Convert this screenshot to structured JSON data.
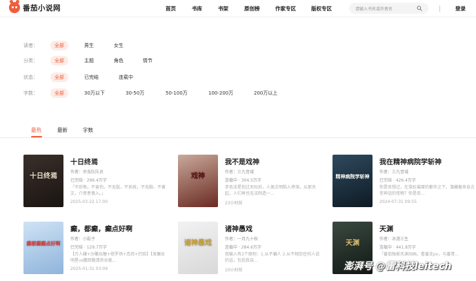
{
  "header": {
    "logo_text": "番茄小说网",
    "nav": [
      "首页",
      "书库",
      "书架",
      "原创榜",
      "作家专区",
      "版权专区"
    ],
    "active_nav": 1,
    "search_placeholder": "请输入书名或作者名",
    "login_label": "登录"
  },
  "filters": [
    {
      "label": "读者：",
      "options": [
        "全部",
        "男生",
        "女生"
      ]
    },
    {
      "label": "分类：",
      "options": [
        "全部",
        "主题",
        "角色",
        "情节"
      ]
    },
    {
      "label": "状态：",
      "options": [
        "全部",
        "已完结",
        "连载中"
      ]
    },
    {
      "label": "字数：",
      "options": [
        "全部",
        "30万以下",
        "30-50万",
        "50-100万",
        "100-200万",
        "200万以上"
      ]
    }
  ],
  "sort_tabs": [
    "最热",
    "最新",
    "字数"
  ],
  "books": [
    {
      "title": "十日终焉",
      "author": "作者：杀虫队队员",
      "status": "已完结 · 296.4万字",
      "desc": "「不后悔，不害怕，不无敌，不系统，不无脑，不黄文，介意者慎入。」",
      "time": "2025-03-22 17:00",
      "cover_text": "十日终焉",
      "colors": {
        "c1": "#3a2f2a",
        "c2": "#1a1512",
        "text": "#e8dcc5"
      }
    },
    {
      "title": "我不是戏神",
      "author": "作者：三九音域",
      "status": "连载中 · 304.5万字",
      "desc": "赤色流星划过天际后，人类文明陷入停滞。从那天起，人们再也无法制造一…",
      "time": "23小时前",
      "cover_text": "戏神",
      "colors": {
        "c1": "#c9a99a",
        "c2": "#6a2a22",
        "text": "#5a1010"
      }
    },
    {
      "title": "我在精神病院学斩神",
      "author": "作者：三九音域",
      "status": "已完结 · 426.4万字",
      "desc": "你是否想过，在霓虹璀璨的都市之下，潜藏着来自古老神话的怪物？你是否…",
      "time": "2024-07-31 09:55",
      "cover_text": "精神病院学斩神",
      "colors": {
        "c1": "#2e4a5e",
        "c2": "#0f1a24",
        "text": "#ffffff"
      }
    },
    {
      "title": "癫，都癫，癫点好啊",
      "author": "作者：小鬆子",
      "status": "已完结 · 129.7万字",
      "desc": "【万人嫌+沙雕玩梗+修罗场+恋综+打脸】【发癫女明星vs撒回路清奇总裁…",
      "time": "2025-01-31 03:09",
      "cover_text": "癫都癫癫点好啊",
      "colors": {
        "c1": "#cfe3f5",
        "c2": "#8fb4db",
        "text": "#d93a3a"
      }
    },
    {
      "title": "诸神愚戏",
      "author": "作者：一月九十秋",
      "status": "连载中 · 284.6万字",
      "desc": "我输入有2个原则：1.从不骗人 2.从不相信任何人说的话，包括我自…",
      "time": "10小时前",
      "cover_text": "诸神愚戏",
      "colors": {
        "c1": "#f2f2f2",
        "c2": "#d8d8d8",
        "text": "#c8a030"
      }
    },
    {
      "title": "天渊",
      "author": "作者：冰漫三生",
      "status": "连载中 · 441.8万字",
      "desc": "「番茄独家天渊动画，看番支pv，与番青…",
      "time": "",
      "cover_text": "天渊",
      "colors": {
        "c1": "#3a4a40",
        "c2": "#121815",
        "text": "#e0c070"
      }
    }
  ],
  "watermark": "澎湃号 @雷科技leitech",
  "accent": "#f25c3b"
}
